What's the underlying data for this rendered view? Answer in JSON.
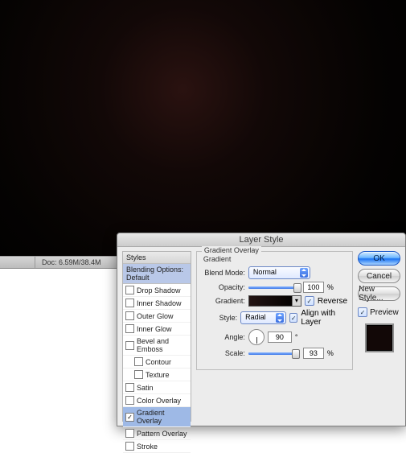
{
  "statusbar": {
    "zoom_pct": "",
    "doc": "Doc: 6.59M/38.4M"
  },
  "dialog": {
    "title": "Layer Style",
    "sidebar": {
      "header": "Styles",
      "blending": "Blending Options: Default",
      "items": [
        {
          "label": "Drop Shadow",
          "checked": false,
          "sub": false
        },
        {
          "label": "Inner Shadow",
          "checked": false,
          "sub": false
        },
        {
          "label": "Outer Glow",
          "checked": false,
          "sub": false
        },
        {
          "label": "Inner Glow",
          "checked": false,
          "sub": false
        },
        {
          "label": "Bevel and Emboss",
          "checked": false,
          "sub": false
        },
        {
          "label": "Contour",
          "checked": false,
          "sub": true
        },
        {
          "label": "Texture",
          "checked": false,
          "sub": true
        },
        {
          "label": "Satin",
          "checked": false,
          "sub": false
        },
        {
          "label": "Color Overlay",
          "checked": false,
          "sub": false
        },
        {
          "label": "Gradient Overlay",
          "checked": true,
          "sub": false,
          "active": true
        },
        {
          "label": "Pattern Overlay",
          "checked": false,
          "sub": false
        },
        {
          "label": "Stroke",
          "checked": false,
          "sub": false
        }
      ]
    },
    "group": {
      "legend": "Gradient Overlay",
      "inner": "Gradient",
      "blendmode_label": "Blend Mode:",
      "blendmode_value": "Normal",
      "opacity_label": "Opacity:",
      "opacity_value": "100",
      "pct": "%",
      "gradient_label": "Gradient:",
      "reverse_label": "Reverse",
      "reverse_checked": true,
      "style_label": "Style:",
      "style_value": "Radial",
      "align_label": "Align with Layer",
      "align_checked": true,
      "angle_label": "Angle:",
      "angle_value": "90",
      "deg": "°",
      "scale_label": "Scale:",
      "scale_value": "93"
    },
    "buttons": {
      "ok": "OK",
      "cancel": "Cancel",
      "newstyle": "New Style...",
      "preview": "Preview",
      "preview_checked": true
    }
  }
}
